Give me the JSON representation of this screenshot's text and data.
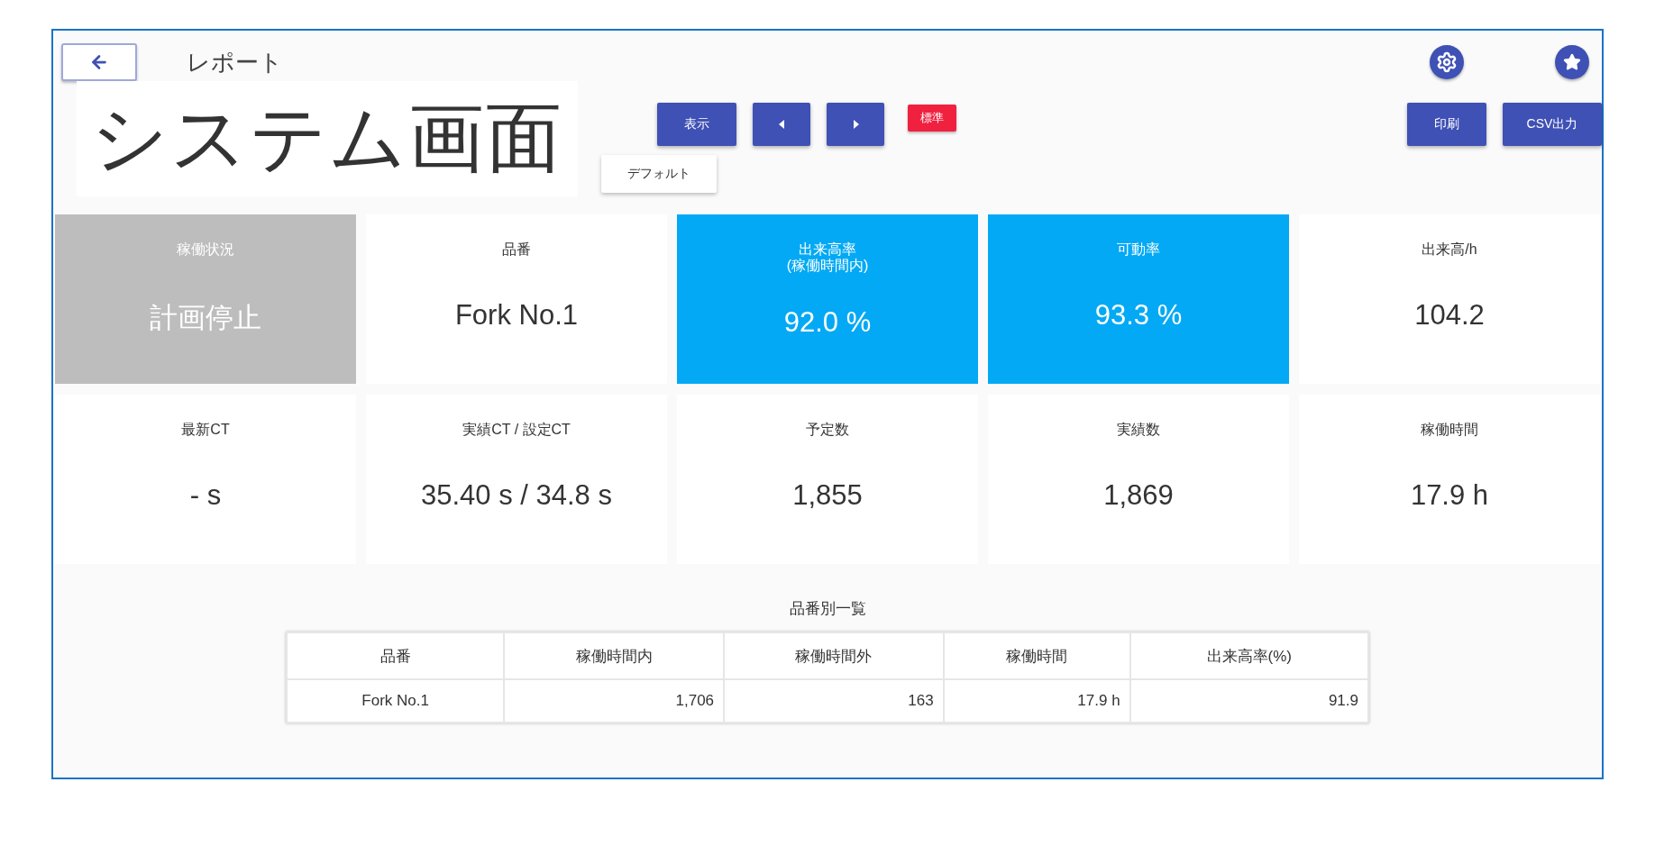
{
  "header": {
    "title": "レポート"
  },
  "overlay_label": "システム画面",
  "toolbar": {
    "buttons": [
      {
        "kind": "text",
        "label": "表示"
      },
      {
        "kind": "prev"
      },
      {
        "kind": "next"
      }
    ],
    "badge": "標準",
    "right_buttons": [
      "印刷",
      "CSV出力"
    ],
    "secondary_buttons": [
      "デフォルト"
    ]
  },
  "cards": [
    {
      "label": "稼働状況",
      "value": "計画停止",
      "color": "#bdbdbd"
    },
    {
      "label": "品番",
      "value": "Fork No.1",
      "color": "#ffffff"
    },
    {
      "label": "出来高率\n(稼働時間内)",
      "value": "92.0 %",
      "color": "#03a9f4"
    },
    {
      "label": "可動率",
      "value": "93.3 %",
      "color": "#03a9f4"
    },
    {
      "label": "出来高/h",
      "value": "104.2",
      "color": "#ffffff"
    },
    {
      "label": "最新CT",
      "value": "- s",
      "color": "#ffffff"
    },
    {
      "label": "実績CT / 設定CT",
      "value": "35.40 s / 34.8 s",
      "color": "#ffffff"
    },
    {
      "label": "予定数",
      "value": "1,855",
      "color": "#ffffff"
    },
    {
      "label": "実績数",
      "value": "1,869",
      "color": "#ffffff"
    },
    {
      "label": "稼働時間",
      "value": "17.9 h",
      "color": "#ffffff"
    }
  ],
  "table": {
    "title": "品番別一覧",
    "columns": [
      "品番",
      "稼働時間内",
      "稼働時間外",
      "稼働時間",
      "出来高率(%)"
    ],
    "rows": [
      [
        "Fork No.1",
        "1,706",
        "163",
        "17.9 h",
        "91.9"
      ]
    ]
  }
}
